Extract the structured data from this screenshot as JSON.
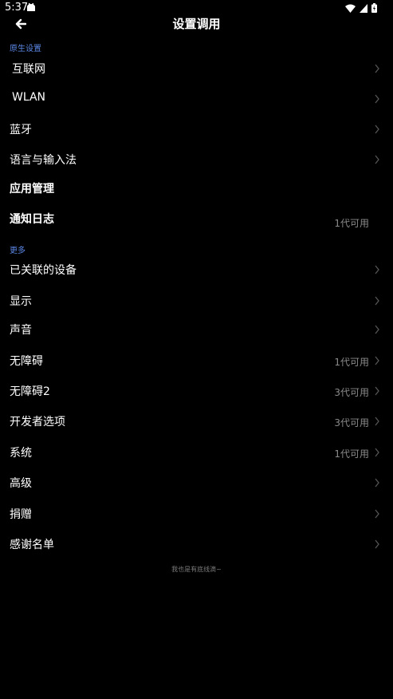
{
  "status_bar": {
    "time": "5:37",
    "icons": [
      "notification-icon",
      "wifi-icon",
      "signal-icon",
      "battery-icon"
    ]
  },
  "toolbar": {
    "title": "设置调用",
    "back_icon": "back-arrow-icon"
  },
  "sections": {
    "native": "原生设置",
    "more": "更多"
  },
  "rows": {
    "internet": {
      "label": "互联网"
    },
    "wlan": {
      "label": "WLAN"
    },
    "bluetooth": {
      "label": "蓝牙"
    },
    "language": {
      "label": "语言与输入法"
    },
    "app_manage": {
      "label": "应用管理"
    },
    "notif_log": {
      "label": "通知日志",
      "value": "1代可用"
    },
    "connected_devices": {
      "label": "已关联的设备"
    },
    "display": {
      "label": "显示"
    },
    "sound": {
      "label": "声音"
    },
    "accessibility": {
      "label": "无障碍",
      "value": "1代可用"
    },
    "accessibility2": {
      "label": "无障碍2",
      "value": "3代可用"
    },
    "developer": {
      "label": "开发者选项",
      "value": "3代可用"
    },
    "system": {
      "label": "系统",
      "value": "1代可用"
    },
    "advanced": {
      "label": "高级"
    },
    "donate": {
      "label": "捐赠"
    },
    "thanks": {
      "label": "感谢名单"
    }
  },
  "footer": {
    "note": "我也是有底线滴~"
  },
  "colors": {
    "background": "#000000",
    "section_header": "#5b87e6",
    "secondary_text": "#8a8a8a",
    "chevron": "#555555"
  }
}
